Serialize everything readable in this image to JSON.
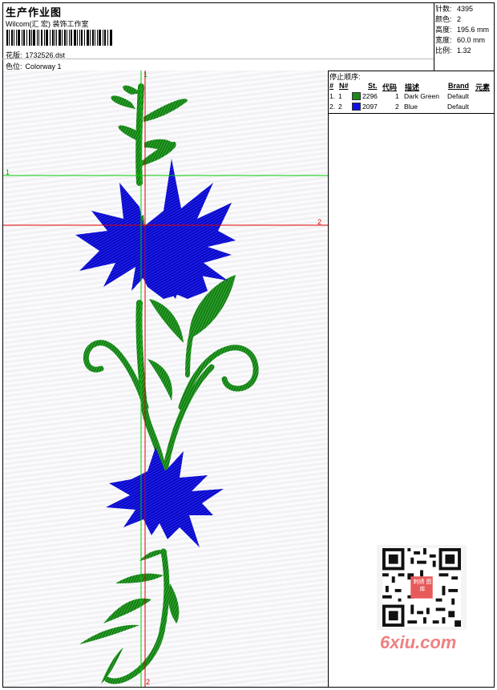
{
  "header": {
    "title": "生产作业图",
    "studio": "Wilcom(汇 宏) 装饰工作室",
    "design_label": "花版:",
    "design_value": "1732526.dst",
    "colorway_label": "色位:",
    "colorway_value": "Colorway 1"
  },
  "stats": [
    {
      "label": "针数:",
      "value": "4395"
    },
    {
      "label": "颜色:",
      "value": "2"
    },
    {
      "label": "高度:",
      "value": "195.6 mm"
    },
    {
      "label": "宽度:",
      "value": "60.0 mm"
    },
    {
      "label": "比例:",
      "value": "1.32"
    }
  ],
  "stop_sequence": {
    "title": "停止顺序:",
    "headers": [
      "#",
      "N#",
      "St.",
      "代码",
      "描述",
      "Brand",
      "元素"
    ],
    "rows": [
      {
        "index": "1.",
        "needle": "1",
        "color": "#1a8a1a",
        "stitches": "2296",
        "code": "1",
        "description": "Dark Green",
        "brand": "Default"
      },
      {
        "index": "2.",
        "needle": "2",
        "color": "#1010e0",
        "stitches": "2097",
        "code": "2",
        "description": "Blue",
        "brand": "Default"
      }
    ]
  },
  "guides": {
    "h1_label": "1",
    "h2_label": "2",
    "v1_label": "1",
    "v2_label": "2",
    "green": "#00cc00",
    "red": "#e00000"
  },
  "watermark": {
    "text": "6xiu.com",
    "stamp_text": "刺绣 图库"
  }
}
